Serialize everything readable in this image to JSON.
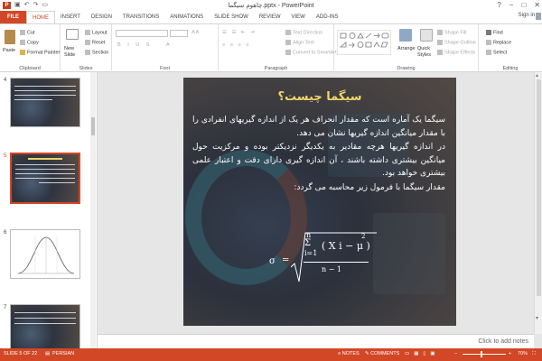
{
  "window": {
    "title": "چاهوم سیگما.pptx - PowerPoint",
    "controls": [
      "?",
      "−",
      "□",
      "✕"
    ]
  },
  "tabs": [
    "FILE",
    "HOME",
    "INSERT",
    "DESIGN",
    "TRANSITIONS",
    "ANIMATIONS",
    "SLIDE SHOW",
    "REVIEW",
    "VIEW",
    "ADD-INS"
  ],
  "signin": "Sign in",
  "ribbon": {
    "clipboard": {
      "paste": "Paste",
      "cut": "Cut",
      "copy": "Copy",
      "format_painter": "Format Painter",
      "label": "Clipboard"
    },
    "slides": {
      "new_slide": "New Slide",
      "layout": "Layout",
      "reset": "Reset",
      "section": "Section",
      "label": "Slides"
    },
    "font": {
      "label": "Font"
    },
    "paragraph": {
      "text_direction": "Text Direction",
      "align_text": "Align Text",
      "convert_smartart": "Convert to SmartArt",
      "label": "Paragraph"
    },
    "drawing": {
      "arrange": "Arrange",
      "quick_styles": "Quick Styles",
      "shape_fill": "Shape Fill",
      "shape_outline": "Shape Outline",
      "shape_effects": "Shape Effects",
      "label": "Drawing"
    },
    "editing": {
      "find": "Find",
      "replace": "Replace",
      "select": "Select",
      "label": "Editing"
    }
  },
  "thumbnails": [
    {
      "num": "4"
    },
    {
      "num": "5"
    },
    {
      "num": "6"
    },
    {
      "num": "7"
    }
  ],
  "slide": {
    "title": "سیگما چیست؟",
    "para1": "سیگما یک آماره است که مقدار انحراف هر یک از اندازه گیریهای انفرادی را با مقدار میانگین اندازه گیریها نشان می دهد.",
    "para2": "در اندازه گیریها هرچه مقادیر به یکدیگر نزدیکتر بوده و مرکزیت حول میانگین بیشتری داشته باشند ، آن اندازه گیری دارای دقت و اعتبار علمی بیشتری خواهد بود.",
    "para3": "مقدار سیگما با فرمول زیر محاسبه می گردد:",
    "formula": {
      "sigma": "σ",
      "eq": "=",
      "n_top": "n",
      "sum": "Σ",
      "i1": "i=1",
      "paren": "( X i − μ )",
      "pow": "2",
      "den": "n − 1"
    }
  },
  "notes_placeholder": "Click to add notes",
  "status": {
    "slide_count": "SLIDE 5 OF 22",
    "language": "PERSIAN",
    "notes": "NOTES",
    "comments": "COMMENTS",
    "zoom": "70%"
  }
}
